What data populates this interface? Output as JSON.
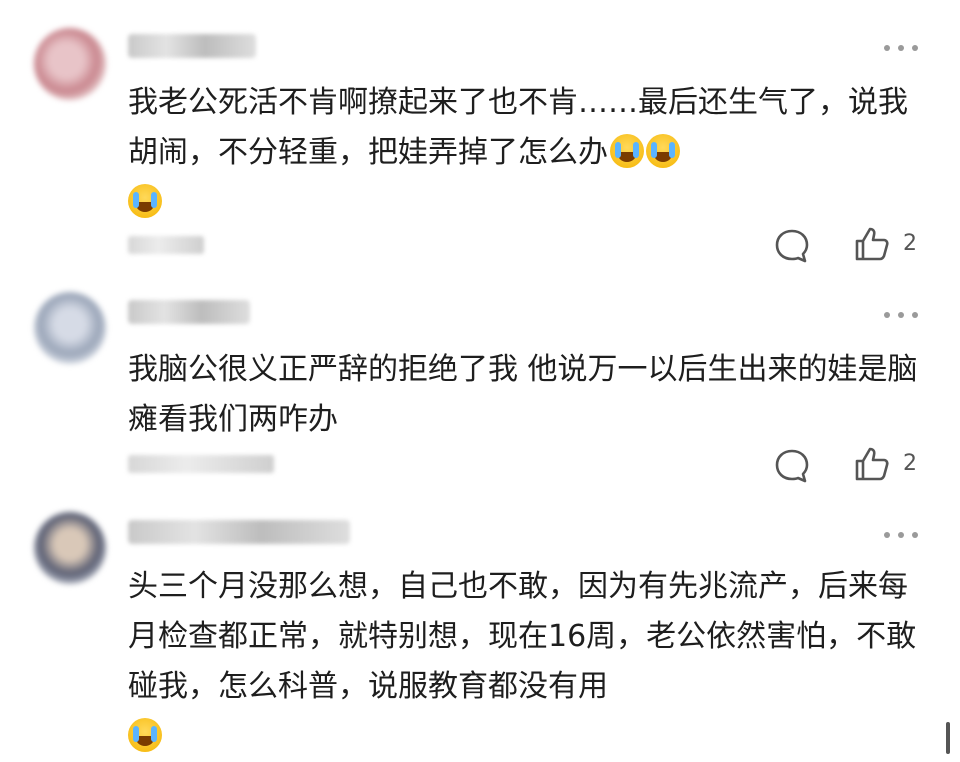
{
  "comments": [
    {
      "text": "我老公死活不肯啊撩起来了也不肯……最后还生气了，说我胡闹，不分轻重，把娃弄掉了怎么办",
      "trailing_emojis": [
        "crying-emoji",
        "crying-emoji",
        "crying-emoji"
      ],
      "likes": "2"
    },
    {
      "text": "我脑公很义正严辞的拒绝了我 他说万一以后生出来的娃是脑瘫看我们两咋办",
      "trailing_emojis": [],
      "likes": "2"
    },
    {
      "text": "头三个月没那么想，自己也不敢，因为有先兆流产，后来每月检查都正常，就特别想，现在16周，老公依然害怕，不敢碰我，怎么科普，说服教育都没有用",
      "trailing_emojis": [
        "laughing-crying-emoji"
      ]
    }
  ]
}
